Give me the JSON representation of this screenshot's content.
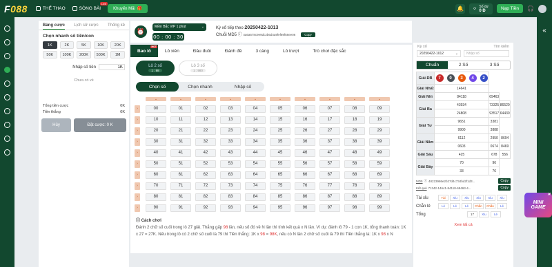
{
  "header": {
    "logo_a": "F",
    "logo_b": "088",
    "nav_sports": "THỂ THAO",
    "nav_casino": "SÒNG BÀI",
    "live_badge": "Live",
    "promo": "Khuyến Mãi",
    "balance_label": "Số dư",
    "balance_value": "0 Đ",
    "deposit": "Nạp Tiền"
  },
  "left": {
    "tabs": [
      "Bảng cược",
      "Lịch sử cược",
      "Thống kê"
    ],
    "heading": "Chọn nhanh số tiền/con",
    "chips": [
      "1K",
      "2K",
      "5K",
      "10K",
      "20K",
      "50K",
      "100K",
      "200K",
      "500K",
      "1M"
    ],
    "amount_label": "Nhập số tiền",
    "amount_value": "1K",
    "empty": "Chưa có vé",
    "total_label": "Tổng tiền cược",
    "total_value": "0K",
    "win_label": "Tiền thắng",
    "win_value": "0K",
    "cancel": "Hủy",
    "place": "Đặt cược: 0 K"
  },
  "game": {
    "select": "Miền Bắc VIP 1 phút",
    "timer": "00 : 00 : 30",
    "next_label": "Kỳ xổ tiếp theo",
    "next_value": "20250422-1013",
    "md5_label": "Chuỗi MD5",
    "md5_value": "4a6a678c9e9dc2b6d4a9fef89f58ee06",
    "copy": "Copy"
  },
  "tabs": [
    {
      "label": "Bao lô",
      "hot": "HOT"
    },
    {
      "label": "Lô xiên"
    },
    {
      "label": "Đầu đuôi"
    },
    {
      "label": "Đánh đề"
    },
    {
      "label": "3 càng"
    },
    {
      "label": "Lô trượt"
    },
    {
      "label": "Trò chơi đặc sắc"
    }
  ],
  "subtypes": [
    {
      "label": "Lô 2 số",
      "odds": "1 : 98"
    },
    {
      "label": "Lô 3 số",
      "odds": "1 : 980"
    }
  ],
  "pick_modes": [
    "Chọn số",
    "Chọn nhanh",
    "Nhập số"
  ],
  "grid": {
    "rows": [
      [
        "00",
        "01",
        "02",
        "03",
        "04",
        "05",
        "06",
        "07",
        "08",
        "09"
      ],
      [
        "10",
        "11",
        "12",
        "13",
        "14",
        "15",
        "16",
        "17",
        "18",
        "19"
      ],
      [
        "20",
        "21",
        "22",
        "23",
        "24",
        "25",
        "26",
        "27",
        "28",
        "29"
      ],
      [
        "30",
        "31",
        "32",
        "33",
        "34",
        "35",
        "36",
        "37",
        "38",
        "39"
      ],
      [
        "40",
        "41",
        "42",
        "43",
        "44",
        "45",
        "46",
        "47",
        "48",
        "49"
      ],
      [
        "50",
        "51",
        "52",
        "53",
        "54",
        "55",
        "56",
        "57",
        "58",
        "59"
      ],
      [
        "60",
        "61",
        "62",
        "63",
        "64",
        "65",
        "66",
        "67",
        "68",
        "69"
      ],
      [
        "70",
        "71",
        "72",
        "73",
        "74",
        "75",
        "76",
        "77",
        "78",
        "79"
      ],
      [
        "80",
        "81",
        "82",
        "83",
        "84",
        "85",
        "86",
        "87",
        "88",
        "89"
      ],
      [
        "90",
        "91",
        "92",
        "93",
        "94",
        "95",
        "96",
        "97",
        "98",
        "99"
      ]
    ]
  },
  "rules": {
    "title": "Cách chơi",
    "p1": "Đánh 2 chữ số cuối trong lô 27 giải. Thắng gấp ",
    "p1h": "98",
    "p2": " lần, nếu số đó về N lần thì tính kết quả x N lần. Ví dụ: đánh lô 79 - 1 con 1K, tổng thanh toán: 1K x 27 = 27K. Nếu trong lô có 2 chữ số cuối là 79 thì Tiền thắng: 1K x ",
    "p2h": "98",
    "p3": " = ",
    "p3h": "98K",
    "p4": ", nếu có N lần 2 chữ số cuối là 79 thì Tiền thắng là: 1K x ",
    "p4h": "98",
    "p5": " x N"
  },
  "results": {
    "draw_label": "Kỳ xổ",
    "search_label": "Tìm kiếm",
    "draw_value": "20250422-1012",
    "search_placeholder": "Nhập số",
    "tabs": [
      "Chuẩn",
      "2 Số",
      "3 Số"
    ],
    "db_label": "Giải ĐB",
    "db_balls": [
      "7",
      "0",
      "3",
      "4",
      "2"
    ],
    "prizes": [
      {
        "label": "Giải Nhất",
        "values": [
          "14641"
        ]
      },
      {
        "label": "Giải Nhì",
        "values": [
          "84118",
          "69463"
        ]
      },
      {
        "label": "Giải Ba",
        "values": [
          "43934",
          "73325",
          "86520",
          "24808",
          "93517",
          "64430"
        ]
      },
      {
        "label": "Giải Tư",
        "values": [
          "9651",
          "3381",
          "9900",
          "3888"
        ]
      },
      {
        "label": "Giải Năm",
        "values": [
          "6112",
          "2950",
          "8694",
          "0603",
          "0674",
          "8469"
        ]
      },
      {
        "label": "Giải Sáu",
        "values": [
          "425",
          "678",
          "556"
        ]
      },
      {
        "label": "Giải Bảy",
        "values": [
          "70",
          "96",
          "33",
          "76"
        ]
      }
    ],
    "md5_label": "MD5",
    "md5_value": "48223986e2b27d4c734bd2f1d3...",
    "result_label": "Kết quả",
    "result_value": "71342-14641-84118-69463-4...",
    "copy": "Copy",
    "stats": [
      {
        "label": "Tài xỉu",
        "items": [
          "Tài",
          "Xỉu",
          "Xỉu",
          "Xỉu",
          "Xỉu",
          "Xỉu"
        ]
      },
      {
        "label": "Chẵn lẻ",
        "items": [
          "Lẻ",
          "Lẻ",
          "Lẻ",
          "Chẵn",
          "Chẵn",
          "Lẻ"
        ]
      },
      {
        "label": "Tổng",
        "items": [
          "17",
          "Xỉu",
          "Lẻ"
        ]
      }
    ],
    "more": "Xem tất cả"
  },
  "colors": {
    "ball1": "#c92a2a",
    "ball2": "#495057",
    "ball3": "#e8590c",
    "ball4": "#7048e8",
    "ball5": "#364fc7"
  },
  "minigame": {
    "line1": "MINI",
    "line2": "GAME"
  }
}
